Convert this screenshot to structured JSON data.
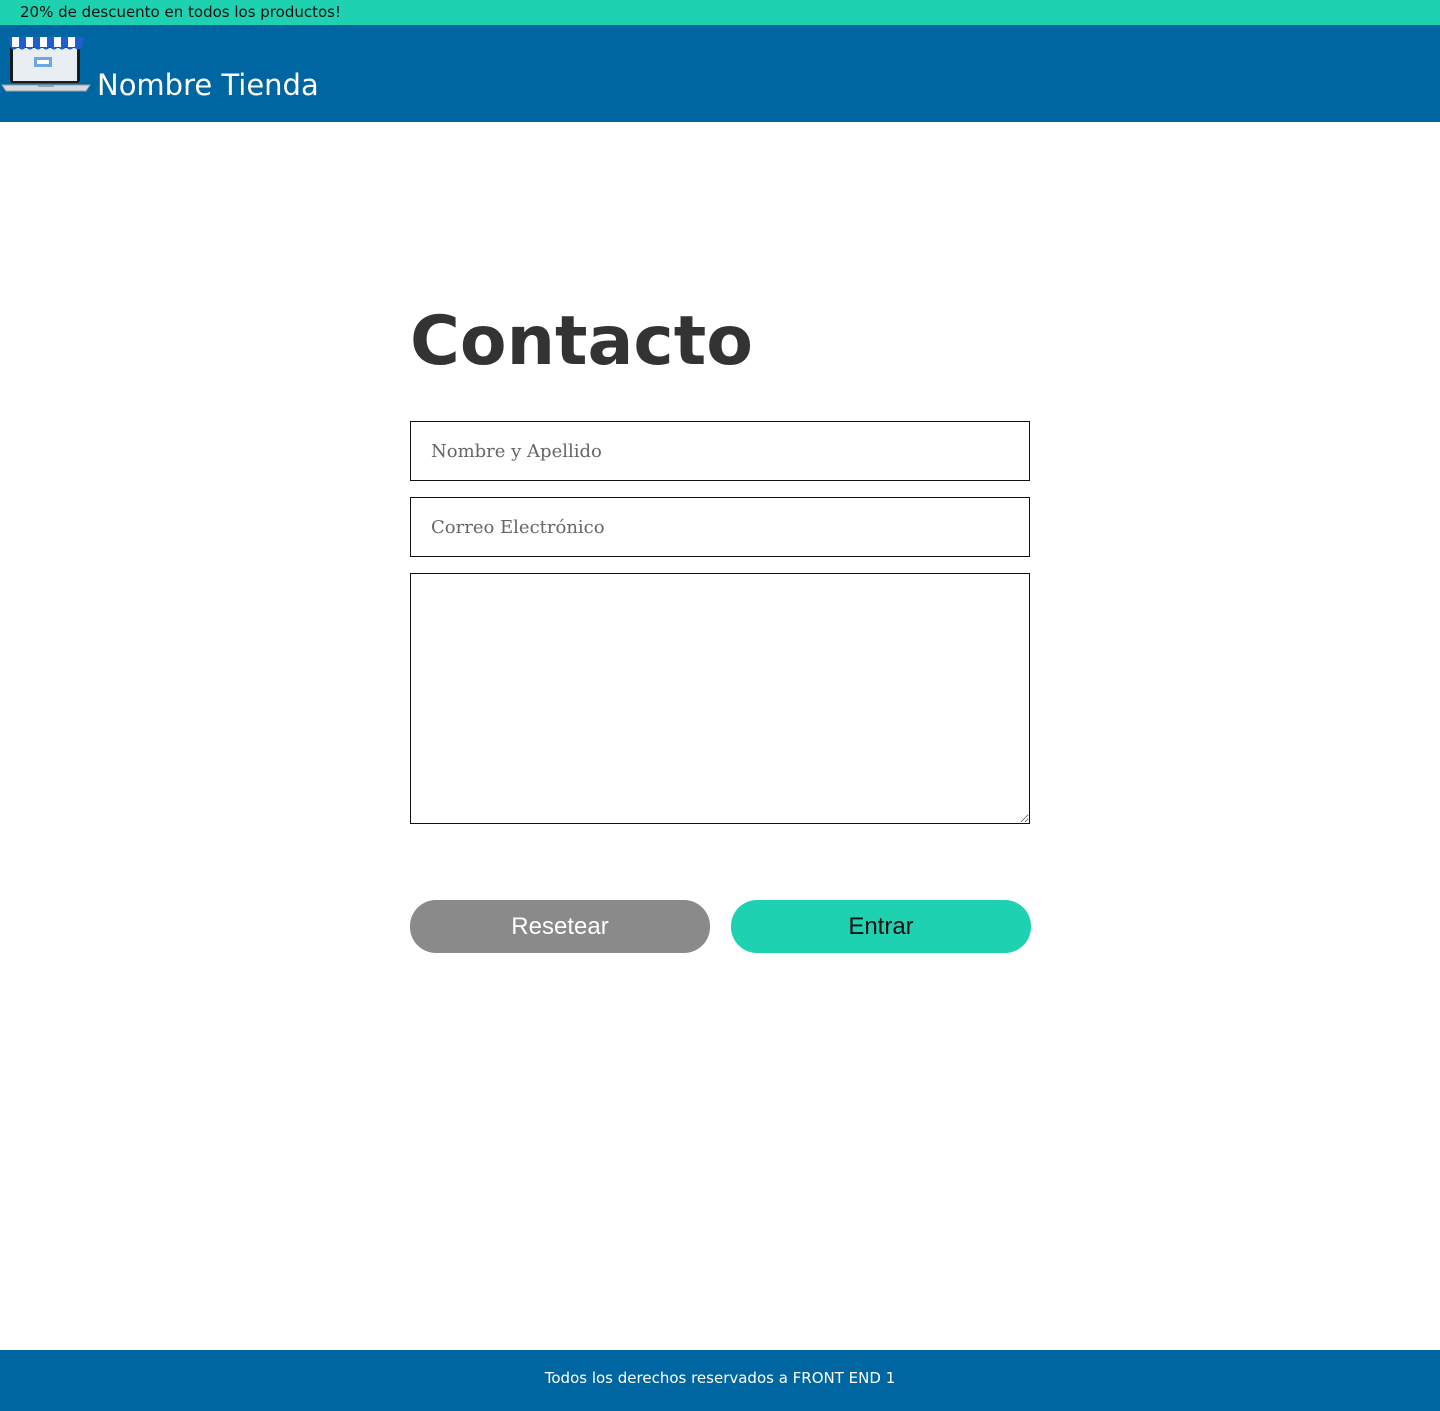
{
  "promo": {
    "text": "20% de descuento en todos los productos!"
  },
  "header": {
    "store_name": "Nombre Tienda",
    "logo_icon": "storefront-laptop-icon"
  },
  "contact": {
    "title": "Contacto",
    "name_placeholder": "Nombre y Apellido",
    "email_placeholder": "Correo Electrónico",
    "message_value": "",
    "reset_label": "Resetear",
    "submit_label": "Entrar"
  },
  "footer": {
    "text": "Todos los derechos reservados a FRONT END 1"
  },
  "colors": {
    "accent": "#1dd1b1",
    "header": "#0066a1",
    "reset_button": "#8a8a8a",
    "title": "#333333"
  }
}
